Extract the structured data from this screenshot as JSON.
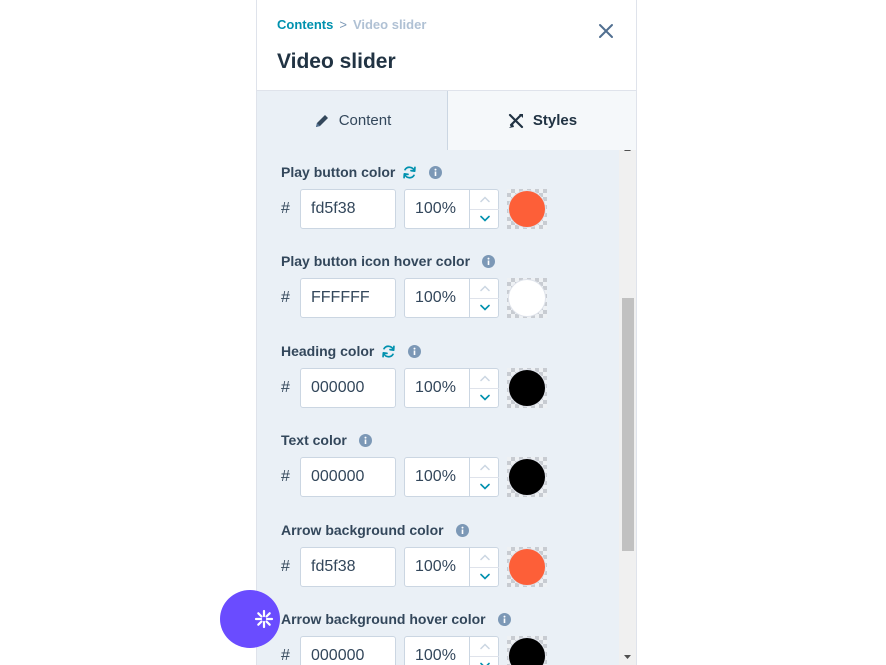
{
  "breadcrumb": {
    "parent": "Contents",
    "separator": ">",
    "current": "Video slider"
  },
  "title": "Video slider",
  "tabs": [
    {
      "label": "Content",
      "icon": "pencil-icon"
    },
    {
      "label": "Styles",
      "icon": "styles-icon"
    }
  ],
  "fields": [
    {
      "label": "Play button color",
      "hex": "fd5f38",
      "opacity": "100%",
      "color": "#fd5f38",
      "has_reset": true
    },
    {
      "label": "Play button icon hover color",
      "hex": "FFFFFF",
      "opacity": "100%",
      "color": "#FFFFFF",
      "has_reset": false
    },
    {
      "label": "Heading color",
      "hex": "000000",
      "opacity": "100%",
      "color": "#000000",
      "has_reset": true
    },
    {
      "label": "Text color",
      "hex": "000000",
      "opacity": "100%",
      "color": "#000000",
      "has_reset": false
    },
    {
      "label": "Arrow background color",
      "hex": "fd5f38",
      "opacity": "100%",
      "color": "#fd5f38",
      "has_reset": false
    },
    {
      "label": "Arrow background hover color",
      "hex": "000000",
      "opacity": "100%",
      "color": "#000000",
      "has_reset": false
    }
  ],
  "hash_symbol": "#",
  "colors": {
    "accent": "#0091ae",
    "fab": "#6a4cff"
  }
}
